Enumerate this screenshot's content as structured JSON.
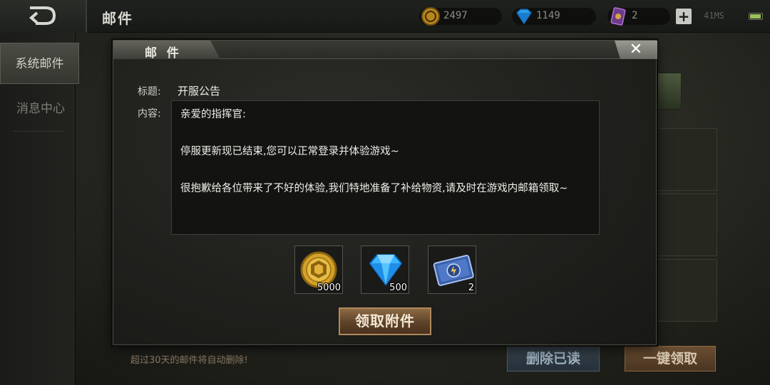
{
  "topbar": {
    "title": "邮件",
    "gold": "2497",
    "diamonds": "1149",
    "tickets": "2",
    "ping": "41MS"
  },
  "sidebar": {
    "tabs": [
      {
        "label": "系统邮件",
        "active": true
      },
      {
        "label": "消息中心",
        "active": false
      }
    ]
  },
  "background": {
    "footnote": "超过30天的邮件将自动删除!",
    "delete_read_label": "删除已读",
    "claim_all_label": "一键领取"
  },
  "dialog": {
    "title": "邮 件",
    "close_label": "✕",
    "subject_label": "标题:",
    "subject": "开服公告",
    "content_label": "内容:",
    "content_lines": [
      "亲爱的指挥官:",
      "停服更新现已结束,您可以正常登录并体验游戏~",
      "很抱歉给各位带来了不好的体验,我们特地准备了补给物资,请及时在游戏内邮箱领取~"
    ],
    "attachments": [
      {
        "icon": "gold-coin-icon",
        "qty": "5000"
      },
      {
        "icon": "diamond-icon",
        "qty": "500"
      },
      {
        "icon": "ticket-card-icon",
        "qty": "2"
      }
    ],
    "claim_label": "领取附件"
  },
  "colors": {
    "gold": "#d4a22a",
    "diamond": "#3bb6ff",
    "accent_button": "#8d6a45"
  }
}
